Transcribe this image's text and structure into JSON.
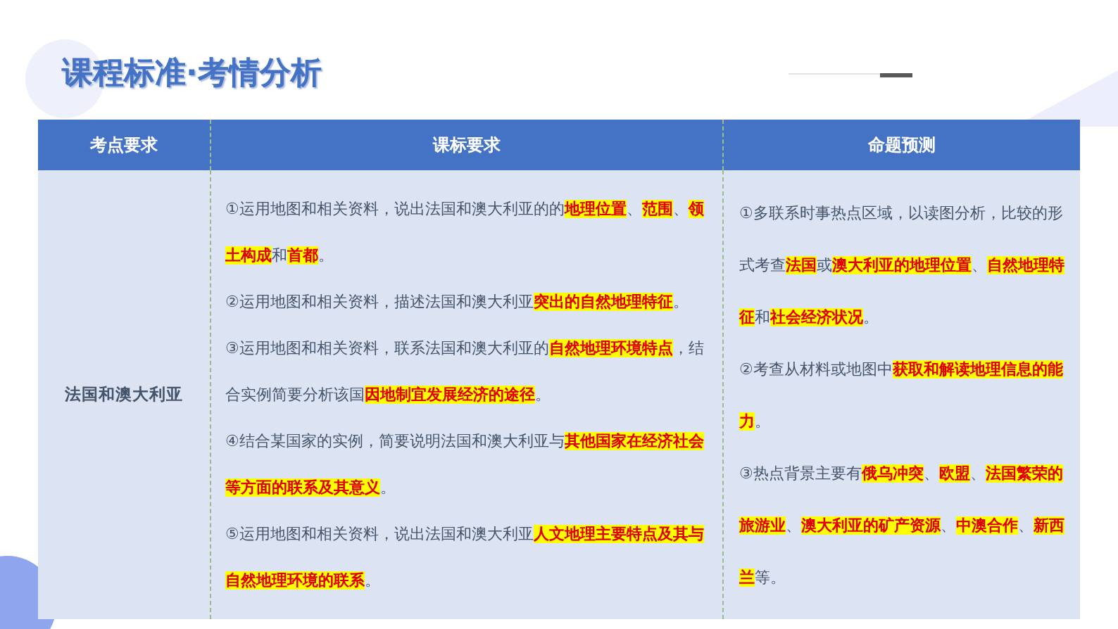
{
  "title": "课程标准·考情分析",
  "table": {
    "columns": [
      "考点要求",
      "课标要求",
      "命题预测"
    ],
    "rows": [
      {
        "topic": "法国和澳大利亚",
        "standards": [
          "①运用地图和相关资料，说出法国和澳大利亚的的**地理位置**、**范围**、**领土构成**和**首都**。",
          "②运用地图和相关资料，描述法国和澳大利亚**突出的自然地理特征**。",
          "③运用地图和相关资料，联系法国和澳大利亚的**自然地理环境特点**，结合实例简要分析该国**因地制宜发展经济的途径**。",
          "④结合某国家的实例，简要说明法国和澳大利亚与**其他国家在经济社会等方面的联系及其意义**。",
          "⑤运用地图和相关资料，说出法国和澳大利亚**人文地理主要特点及其与自然地理环境的联系**。"
        ],
        "predictions": [
          "①多联系时事热点区域，以读图分析，比较的形式考查**法国**或**澳大利亚的地理位置**、**自然地理特征**和**社会经济状况**。",
          "②考查从材料或地图中**获取和解读地理信息的能力**。",
          "③热点背景主要有**俄乌冲突**、**欧盟**、**法国繁荣的旅游业**、**澳大利亚的矿产资源**、**中澳合作**、**新西兰**等。"
        ]
      }
    ]
  }
}
